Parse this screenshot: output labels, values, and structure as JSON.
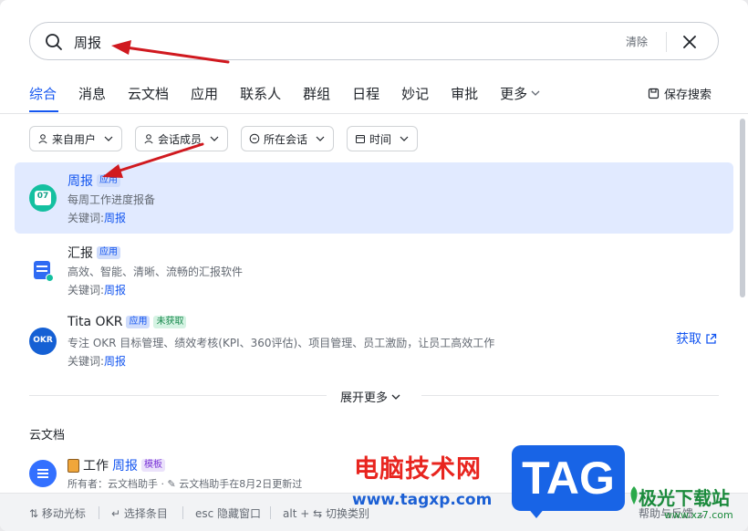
{
  "search": {
    "value": "周报",
    "clear_label": "清除"
  },
  "tabs": [
    {
      "label": "综合",
      "active": true
    },
    {
      "label": "消息"
    },
    {
      "label": "云文档"
    },
    {
      "label": "应用"
    },
    {
      "label": "联系人"
    },
    {
      "label": "群组"
    },
    {
      "label": "日程"
    },
    {
      "label": "妙记"
    },
    {
      "label": "审批"
    },
    {
      "label": "更多"
    }
  ],
  "save_search_label": "保存搜索",
  "filters": [
    {
      "label": "来自用户",
      "icon": "user-icon"
    },
    {
      "label": "会话成员",
      "icon": "user-icon"
    },
    {
      "label": "所在会话",
      "icon": "chat-icon"
    },
    {
      "label": "时间",
      "icon": "calendar-icon"
    }
  ],
  "results": [
    {
      "title": "周报",
      "badge": "应用",
      "description": "每周工作进度报备",
      "keyword_label": "关键词:",
      "keyword": "周报",
      "icon_text": "07"
    },
    {
      "title": "汇报",
      "badge": "应用",
      "description": "高效、智能、清晰、流畅的汇报软件",
      "keyword_label": "关键词:",
      "keyword": "周报"
    },
    {
      "title": "Tita OKR",
      "badge": "应用",
      "badge2": "未获取",
      "description": "专注 OKR 目标管理、绩效考核(KPI、360评估)、项目管理、员工激励，让员工高效工作",
      "keyword_label": "关键词:",
      "keyword": "周报",
      "icon_text": "OKR",
      "action": "获取"
    }
  ],
  "expand_more_label": "展开更多",
  "docs_section": {
    "title": "云文档",
    "item": {
      "title_prefix": "工作",
      "title_highlight": "周报",
      "badge": "模板",
      "meta": "所有者：云文档助手 · ✎ 云文档助手在8月2日更新过"
    }
  },
  "footer": {
    "move": "移动光标",
    "select": "选择条目",
    "hide": "隐藏窗口",
    "switch": "切换类别",
    "feedback": "帮助与反馈"
  },
  "watermarks": {
    "cn_name": "电脑技术网",
    "url": "www.tagxp.com",
    "tag": "TAG",
    "site": "极光下载站",
    "site_url": "www.xz7.com"
  },
  "colors": {
    "accent": "#1456f0",
    "selected_bg": "#e1eaff",
    "arrow": "#d0191f"
  }
}
